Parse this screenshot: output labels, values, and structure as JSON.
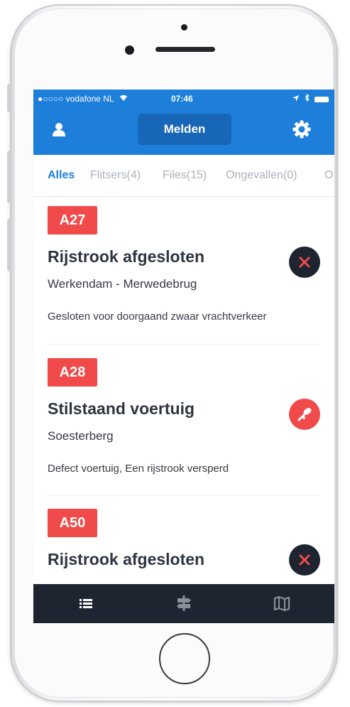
{
  "status_bar": {
    "carrier": "●○○○○ vodafone NL",
    "time": "07:46"
  },
  "nav": {
    "melden_label": "Melden"
  },
  "tabs": [
    {
      "label": "Alles",
      "active": true
    },
    {
      "label": "Flitsers(4)",
      "active": false
    },
    {
      "label": "Files(15)",
      "active": false
    },
    {
      "label": "Ongevallen(0)",
      "active": false
    },
    {
      "label": "O",
      "active": false
    }
  ],
  "incidents": [
    {
      "road": "A27",
      "title": "Rijstrook afgesloten",
      "location": "Werkendam - Merwedebrug",
      "description": "Gesloten voor doorgaand zwaar vrachtverkeer",
      "icon": "close-icon"
    },
    {
      "road": "A28",
      "title": "Stilstaand voertuig",
      "location": "Soesterberg",
      "description": "Defect voertuig, Een rijstrook versperd",
      "icon": "breakdown-icon"
    },
    {
      "road": "A50",
      "title": "Rijstrook afgesloten",
      "location": "",
      "description": "",
      "icon": "close-icon"
    }
  ],
  "colors": {
    "brand_blue": "#1e7fdb",
    "badge_red": "#f04a4b",
    "dark": "#1e2530"
  },
  "tab_bar": [
    "list-icon",
    "signpost-icon",
    "map-icon"
  ]
}
